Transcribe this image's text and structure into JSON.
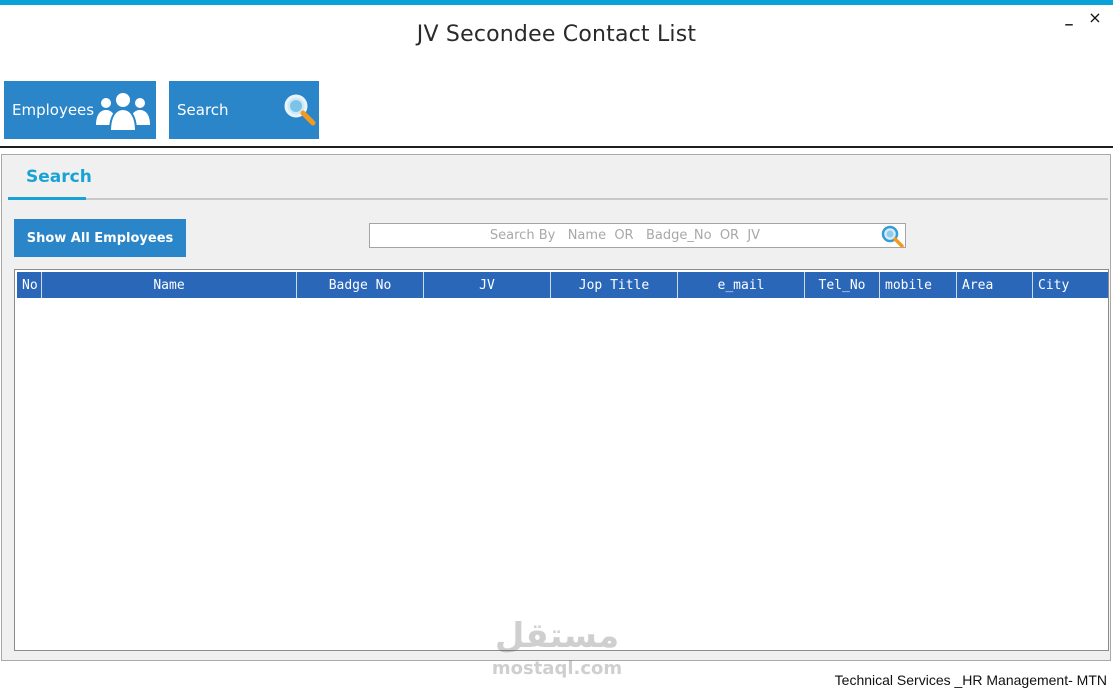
{
  "window": {
    "title": "JV Secondee Contact List",
    "minimize_label": "_",
    "close_label": "×",
    "accent_color": "#0aa3d9"
  },
  "nav": {
    "employees": {
      "label": "Employees",
      "icon": "people-icon"
    },
    "search": {
      "label": "Search",
      "icon": "magnifier-icon"
    },
    "tile_color": "#2a85c9"
  },
  "search_panel": {
    "tab_label": "Search",
    "show_all_label": "Show All Employees",
    "search_placeholder": "Search By   Name  OR   Badge_No  OR  JV",
    "search_value": ""
  },
  "table": {
    "header_color": "#2a67b8",
    "columns": [
      "No",
      "Name",
      "Badge No",
      "JV",
      "Jop Title",
      "e_mail",
      "Tel_No",
      "mobile",
      "Area",
      "City"
    ],
    "rows": []
  },
  "watermark": {
    "arabic": "مستقل",
    "latin": "mostaql.com"
  },
  "footer": {
    "text": "Technical Services _HR Management- MTN"
  }
}
